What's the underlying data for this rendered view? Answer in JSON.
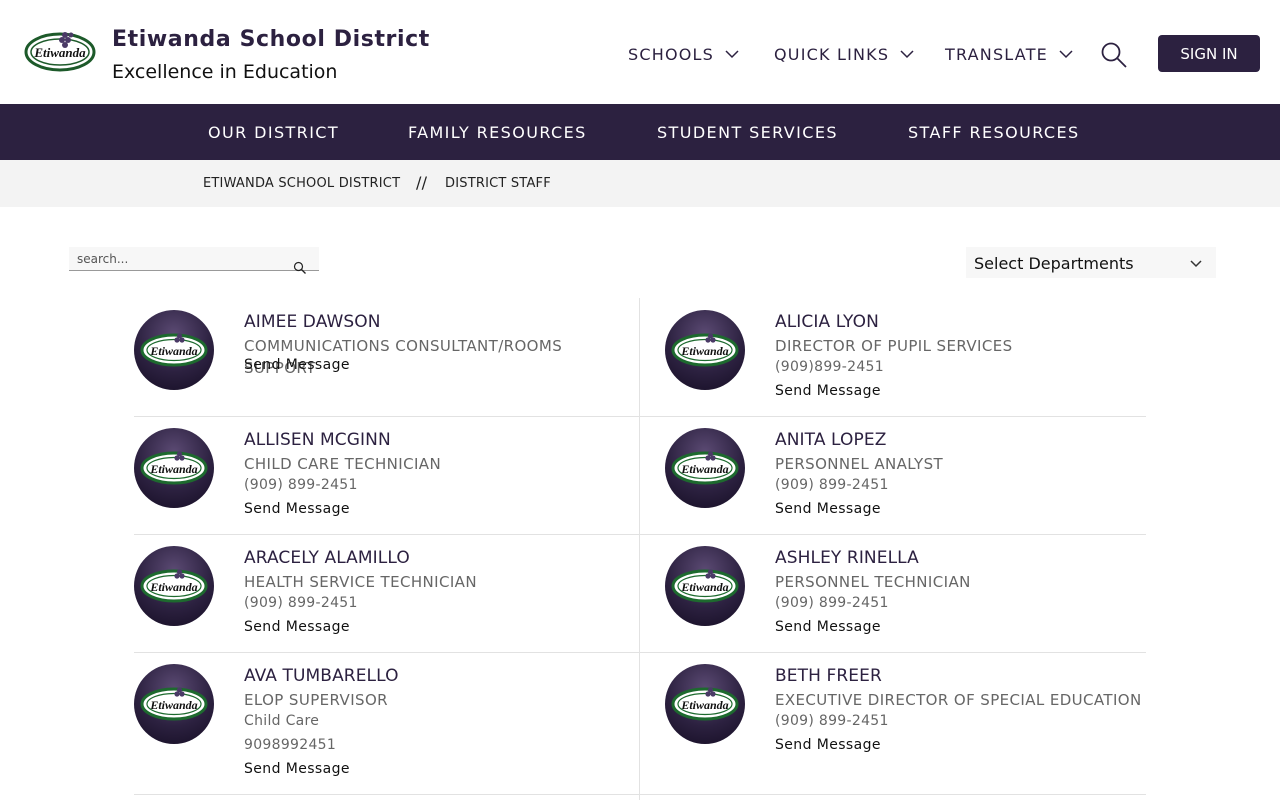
{
  "header": {
    "site_title": "Etiwanda School District",
    "tagline": "Excellence in Education",
    "logo_text": "Etiwanda",
    "nav": [
      {
        "label": "SCHOOLS",
        "icon": "chevron-down-icon"
      },
      {
        "label": "QUICK LINKS",
        "icon": "chevron-down-icon"
      },
      {
        "label": "TRANSLATE",
        "icon": "chevron-down-icon"
      }
    ],
    "search_icon": "search-icon",
    "signin_label": "SIGN IN"
  },
  "main_nav": [
    "OUR DISTRICT",
    "FAMILY RESOURCES",
    "STUDENT SERVICES",
    "STAFF RESOURCES"
  ],
  "breadcrumb": {
    "items": [
      "ETIWANDA SCHOOL DISTRICT",
      "DISTRICT STAFF"
    ],
    "separator": "//"
  },
  "filters": {
    "search_placeholder": "search...",
    "department_select": "Select Departments"
  },
  "staff": [
    {
      "name": "AIMEE DAWSON",
      "title": "COMMUNICATIONS CONSULTANT/ROOMS SUPPORT",
      "extra": [],
      "action": "Send Message"
    },
    {
      "name": "ALICIA LYON",
      "title": "DIRECTOR OF PUPIL SERVICES",
      "extra": [
        "(909)899-2451"
      ],
      "action": "Send Message"
    },
    {
      "name": "ALLISEN MCGINN",
      "title": "CHILD CARE TECHNICIAN",
      "extra": [
        "(909) 899-2451"
      ],
      "action": "Send Message"
    },
    {
      "name": "ANITA LOPEZ",
      "title": "PERSONNEL ANALYST",
      "extra": [
        "(909) 899-2451"
      ],
      "action": "Send Message"
    },
    {
      "name": "ARACELY ALAMILLO",
      "title": "HEALTH SERVICE TECHNICIAN",
      "extra": [
        "(909) 899-2451"
      ],
      "action": "Send Message"
    },
    {
      "name": "ASHLEY RINELLA",
      "title": "PERSONNEL TECHNICIAN",
      "extra": [
        "(909) 899-2451"
      ],
      "action": "Send Message"
    },
    {
      "name": "AVA TUMBARELLO",
      "title": "ELOP SUPERVISOR",
      "extra": [
        "Child Care",
        "9098992451"
      ],
      "action": "Send Message"
    },
    {
      "name": "BETH FREER",
      "title": "EXECUTIVE DIRECTOR OF SPECIAL EDUCATION",
      "extra": [
        "(909) 899-2451"
      ],
      "action": "Send Message"
    }
  ],
  "colors": {
    "brand": "#2c2140",
    "breadcrumb_bg": "#f3f3f3",
    "muted_text": "#666666"
  }
}
